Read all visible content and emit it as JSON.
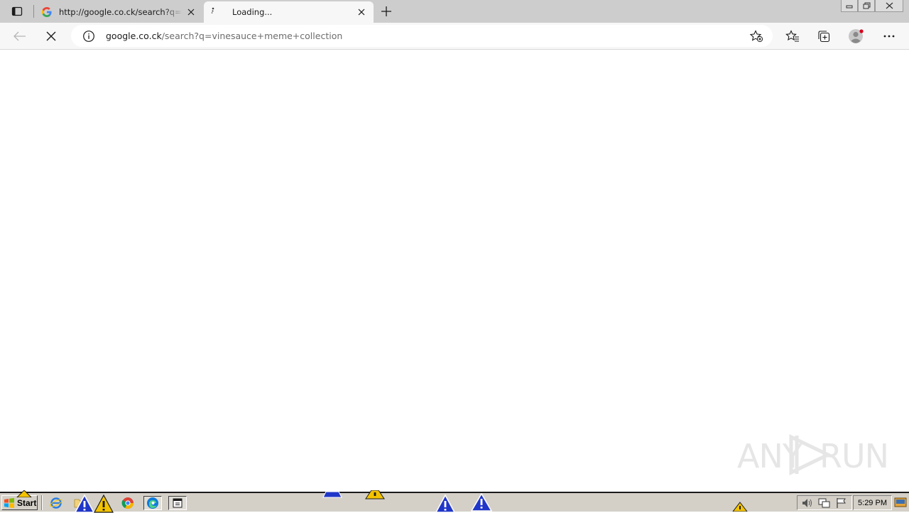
{
  "browser": {
    "tabs": [
      {
        "title": "http://google.co.ck/search?q=bo",
        "active": false,
        "favicon": "google-g-icon"
      },
      {
        "title": "Loading...",
        "active": true,
        "favicon": "loading-icon"
      }
    ],
    "address_bar": {
      "host": "google.co.ck",
      "path": "/search?q=vinesauce+meme+collection"
    }
  },
  "watermark": {
    "text_left": "ANY",
    "text_right": "RUN"
  },
  "taskbar": {
    "start_label": "Start",
    "clock": "5:29 PM"
  },
  "colors": {
    "tabbar": "#cdcdcd",
    "toolbar": "#f7f7f7",
    "taskbar": "#d4d0c8",
    "warning_yellow": "#f3c300",
    "warning_blue": "#2036c8"
  }
}
